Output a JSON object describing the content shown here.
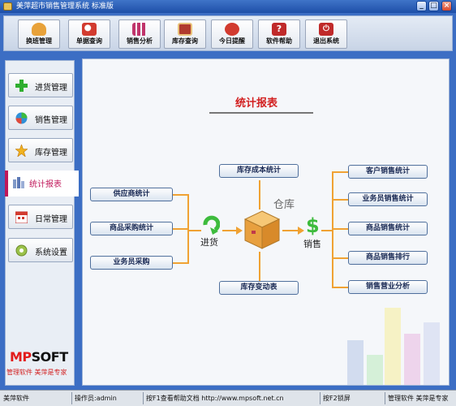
{
  "window": {
    "title": "美萍超市销售管理系统 标准版",
    "buttons": {
      "minimize": "_",
      "maximize": "□",
      "close": "×"
    }
  },
  "toolbar": {
    "buttons": [
      {
        "label": "换班管理",
        "icon": "user-icon",
        "color": "#e8a23a"
      },
      {
        "label": "单据查询",
        "icon": "magnifier-icon",
        "color": "#d23b2f"
      },
      {
        "label": "销售分析",
        "icon": "bar-chart-icon",
        "color": "#c0346b"
      },
      {
        "label": "库存查询",
        "icon": "boxes-icon",
        "color": "#b03a2e"
      },
      {
        "label": "今日提醒",
        "icon": "alarm-clock-icon",
        "color": "#d23b2f"
      },
      {
        "label": "软件帮助",
        "icon": "help-icon",
        "color": "#c02a2a"
      },
      {
        "label": "退出系统",
        "icon": "power-icon",
        "color": "#c02a2a"
      }
    ]
  },
  "nav": {
    "items": [
      {
        "label": "进货管理",
        "icon": "plus-icon",
        "active": false
      },
      {
        "label": "销售管理",
        "icon": "globe-icon",
        "active": false
      },
      {
        "label": "库存管理",
        "icon": "star-icon",
        "active": false
      },
      {
        "label": "统计报表",
        "icon": "bar-chart-icon",
        "active": true
      },
      {
        "label": "日常管理",
        "icon": "calendar-icon",
        "active": false
      },
      {
        "label": "系统设置",
        "icon": "gear-icon",
        "active": false
      }
    ],
    "logo_text": "MPSOFT",
    "slogan": "管理软件 美萍是专家"
  },
  "report": {
    "title": "统计报表",
    "left_items": [
      "供应商统计",
      "商品采购统计",
      "业务员采购"
    ],
    "center_top": "库存成本统计",
    "center_bottom": "库存变动表",
    "right_items": [
      "客户销售统计",
      "业务员销售统计",
      "商品销售统计",
      "商品销售排行",
      "销售营业分析"
    ],
    "purchase_label": "进货",
    "warehouse_label": "仓库",
    "sales_label": "销售"
  },
  "status": {
    "segments": [
      "美萍软件",
      "操作员:admin",
      "按F1查看帮助文档 http://www.mpsoft.net.cn",
      "按F2锁屏",
      "管理软件 美萍是专家"
    ]
  },
  "colors": {
    "accent": "#c0185a",
    "frame": "#3c6ec4",
    "flow": "#f0a233",
    "title": "#d21f1f"
  }
}
